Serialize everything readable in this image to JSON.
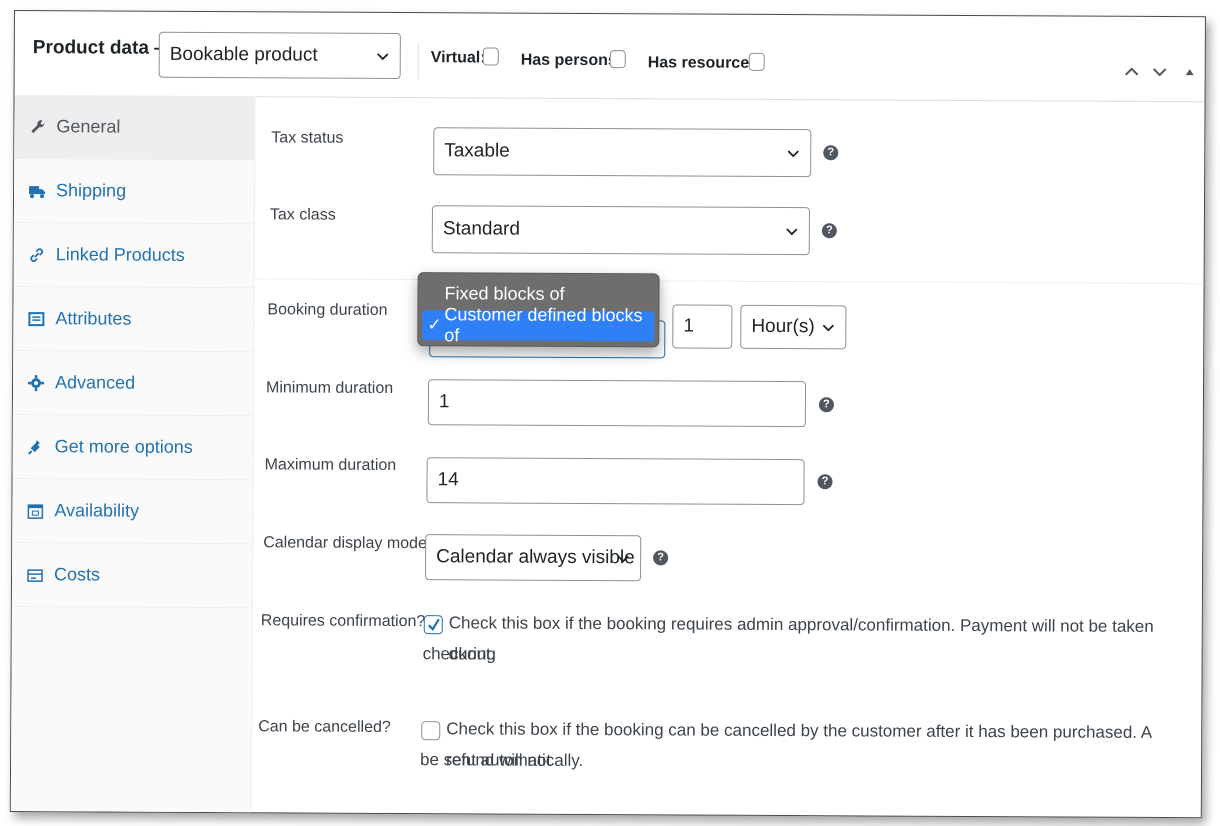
{
  "header": {
    "title": "Product data —",
    "product_type": "Bookable product",
    "virtual_label": "Virtual:",
    "has_persons_label": "Has persons:",
    "has_resources_label": "Has resources:",
    "virtual_checked": false,
    "has_persons_checked": false,
    "has_resources_checked": false
  },
  "sidebar": {
    "items": [
      {
        "label": "General",
        "icon": "wrench-icon",
        "active": true
      },
      {
        "label": "Shipping",
        "icon": "truck-icon"
      },
      {
        "label": "Linked Products",
        "icon": "link-icon"
      },
      {
        "label": "Attributes",
        "icon": "list-icon"
      },
      {
        "label": "Advanced",
        "icon": "gear-icon"
      },
      {
        "label": "Get more options",
        "icon": "plug-icon"
      },
      {
        "label": "Availability",
        "icon": "calendar-icon"
      },
      {
        "label": "Costs",
        "icon": "money-icon"
      }
    ]
  },
  "fields": {
    "tax_status": {
      "label": "Tax status",
      "value": "Taxable"
    },
    "tax_class": {
      "label": "Tax class",
      "value": "Standard"
    },
    "booking_duration": {
      "label": "Booking duration",
      "options": [
        "Fixed blocks of",
        "Customer defined blocks of"
      ],
      "selected": "Customer defined blocks of",
      "amount": "1",
      "unit": "Hour(s)"
    },
    "min_duration": {
      "label": "Minimum duration",
      "value": "1"
    },
    "max_duration": {
      "label": "Maximum duration",
      "value": "14"
    },
    "calendar_mode": {
      "label": "Calendar display mode",
      "value": "Calendar always visible"
    },
    "requires_confirmation": {
      "label": "Requires confirmation?",
      "checked": true,
      "desc_line1": "Check this box if the booking requires admin approval/confirmation. Payment will not be taken during",
      "desc_line2": "checkout."
    },
    "can_be_cancelled": {
      "label": "Can be cancelled?",
      "checked": false,
      "desc_line1": "Check this box if the booking can be cancelled by the customer after it has been purchased. A refund will not",
      "desc_line2": "be sent automatically."
    }
  },
  "help_glyph": "?",
  "check_glyph": "✓",
  "colors": {
    "link": "#2271b1",
    "dropdown_bg": "#6e6e6e",
    "dropdown_selected": "#2f7ff7"
  }
}
